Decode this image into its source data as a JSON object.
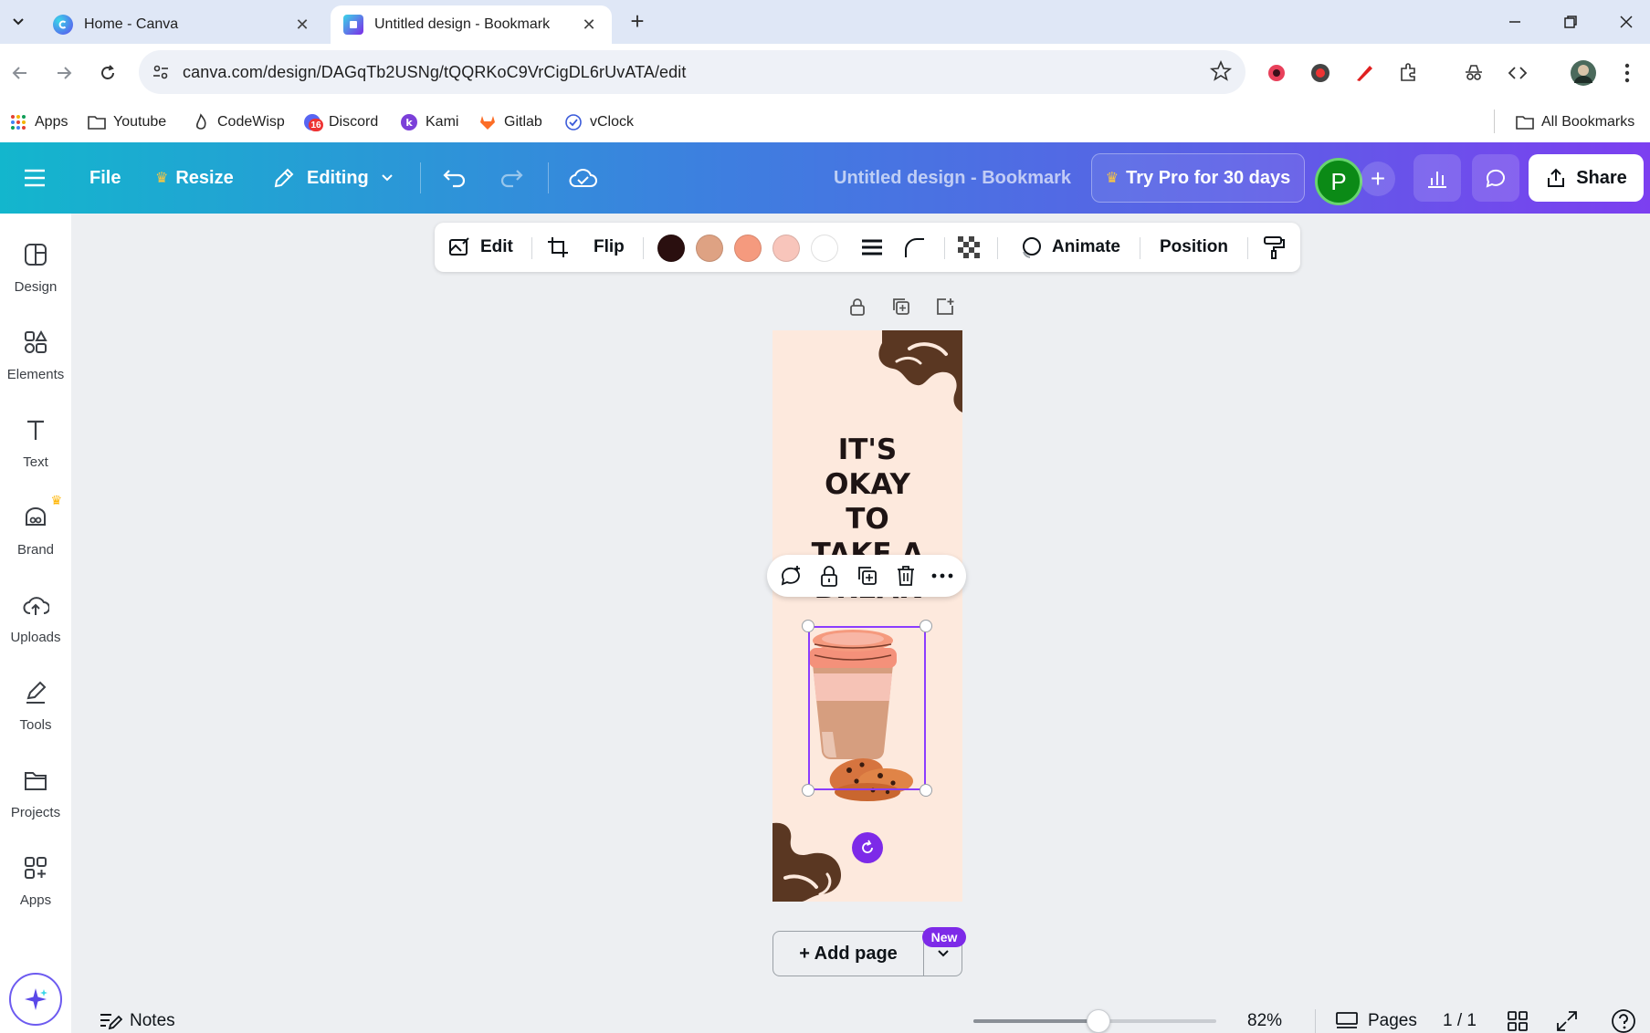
{
  "browser": {
    "tabs": [
      {
        "title": "Home - Canva",
        "active": false
      },
      {
        "title": "Untitled design - Bookmark",
        "active": true
      }
    ],
    "url": "canva.com/design/DAGqTb2USNg/tQQRKoC9VrCigDL6rUvATA/edit",
    "bookmarks": [
      "Apps",
      "Youtube",
      "CodeWisp",
      "Discord",
      "Kami",
      "Gitlab",
      "vClock"
    ],
    "discord_badge": "16",
    "all_bookmarks": "All Bookmarks"
  },
  "canva_header": {
    "file": "File",
    "resize": "Resize",
    "editing": "Editing",
    "design_title": "Untitled design - Bookmark",
    "try_pro": "Try Pro for 30 days",
    "avatar_initial": "P",
    "share": "Share"
  },
  "sidebar": {
    "items": [
      "Design",
      "Elements",
      "Text",
      "Brand",
      "Uploads",
      "Tools",
      "Projects",
      "Apps"
    ]
  },
  "context_toolbar": {
    "edit": "Edit",
    "flip": "Flip",
    "colors": [
      "#2a0f0f",
      "#dea283",
      "#f59a7e",
      "#f8c5bb",
      "#ffffff"
    ],
    "animate": "Animate",
    "position": "Position"
  },
  "design": {
    "headline": "IT'S\nOKAY\nTO\nTAKE A\nBREAK"
  },
  "canvas_footer": {
    "add_page": "+ Add page",
    "new_badge": "New"
  },
  "bottom_bar": {
    "notes": "Notes",
    "zoom": "82%",
    "zoom_level": 0.82,
    "pages": "Pages",
    "page_count": "1 / 1"
  },
  "colors": {
    "canva_purple": "#7d2ae8",
    "page_bg": "#fde9dd",
    "swirl_brown": "#5a3722"
  }
}
